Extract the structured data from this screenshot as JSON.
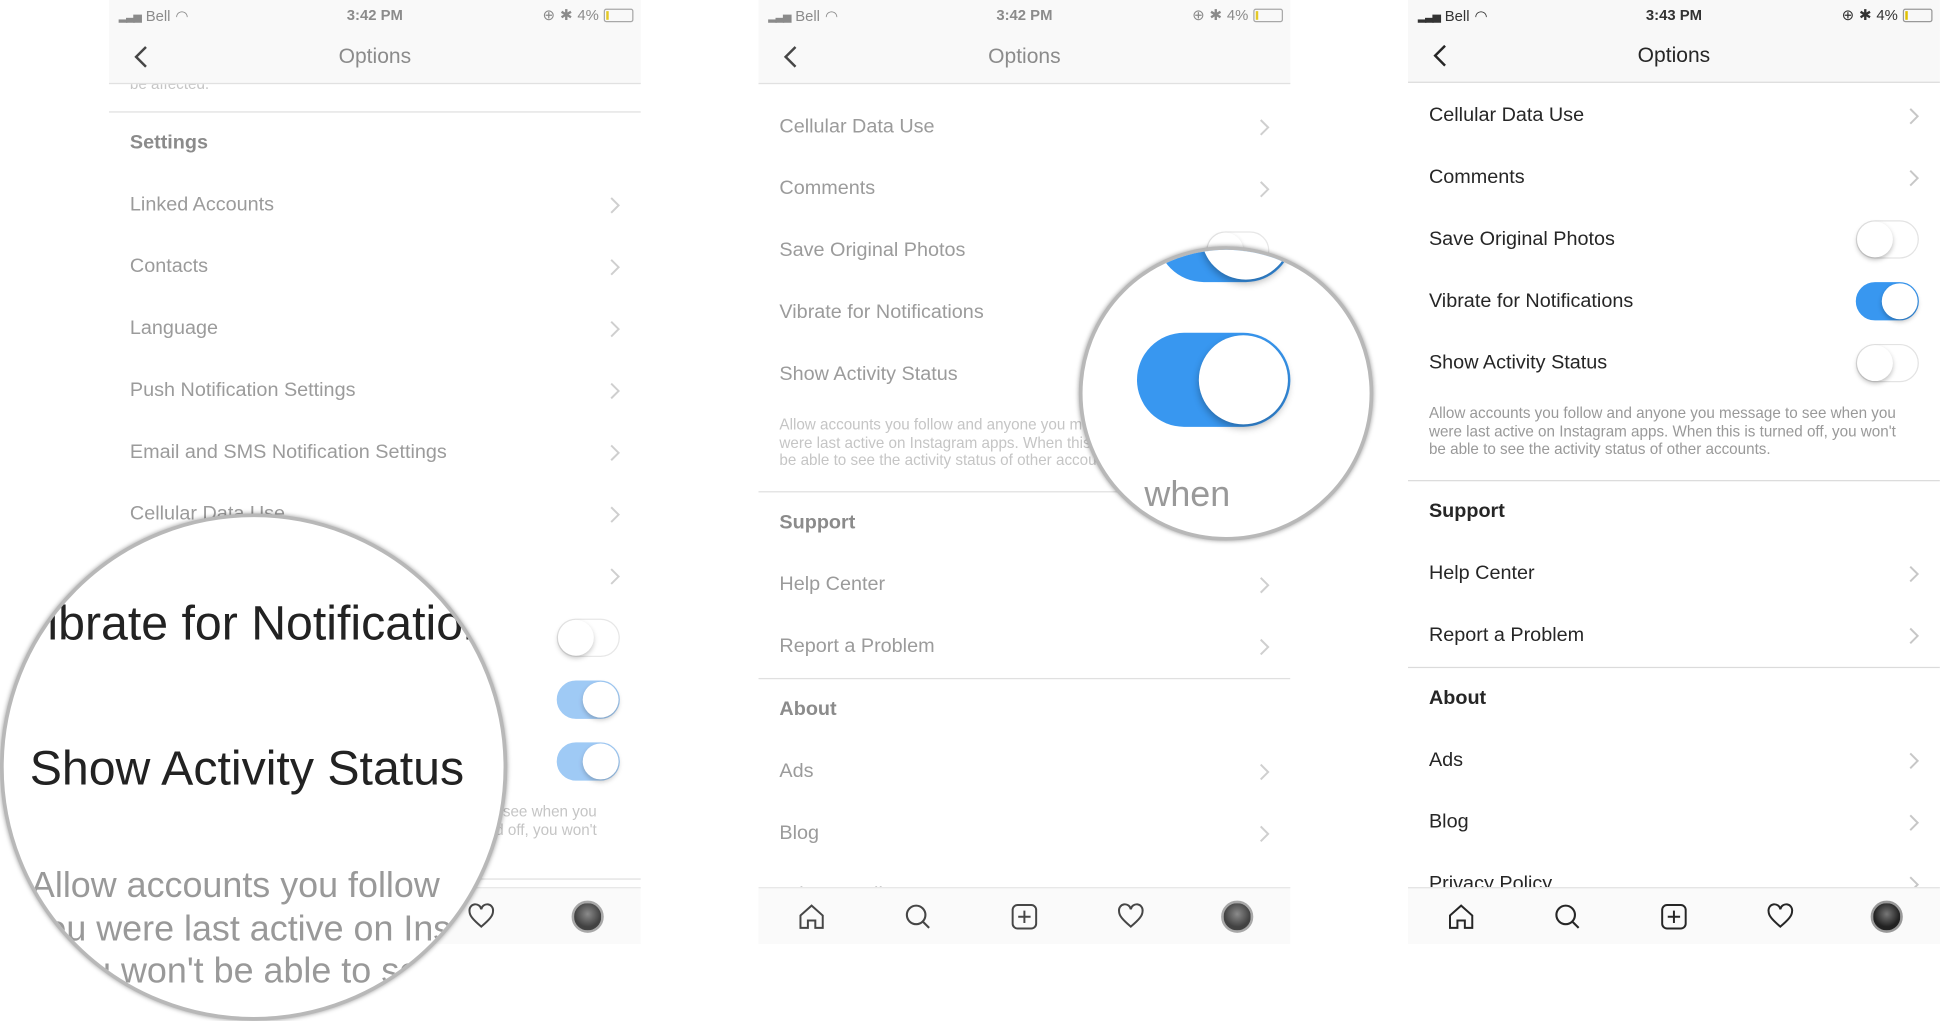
{
  "colors": {
    "accent": "#3897f0",
    "toggle_faded": "#8fc1f4",
    "text": "#262626",
    "muted": "#999999"
  },
  "panels": [
    {
      "faded": true,
      "status": {
        "carrier": "Bell",
        "time": "3:42 PM",
        "battery": "4%"
      },
      "nav": {
        "title": "Options"
      },
      "rows": [
        {
          "type": "desc",
          "text": "be affected."
        },
        {
          "type": "header",
          "label": "Settings"
        },
        {
          "type": "link",
          "label": "Linked Accounts"
        },
        {
          "type": "link",
          "label": "Contacts"
        },
        {
          "type": "link",
          "label": "Language"
        },
        {
          "type": "link",
          "label": "Push Notification Settings"
        },
        {
          "type": "link",
          "label": "Email and SMS Notification Settings"
        },
        {
          "type": "link",
          "label": "Cellular Data Use"
        },
        {
          "type": "link",
          "label": ""
        },
        {
          "type": "toggle",
          "label": "",
          "on": false
        },
        {
          "type": "toggle",
          "label": "",
          "on": true
        },
        {
          "type": "toggle",
          "label": "",
          "on": true
        },
        {
          "type": "desc",
          "text": "Allow accounts you follow and anyone you message to see when you were last active on Instagram apps. When this is turned off, you won't be able to see the activity status of other accounts."
        }
      ],
      "tabs": [
        "home-icon",
        "search-icon",
        "add-icon",
        "heart-icon",
        "profile-avatar"
      ]
    },
    {
      "faded": true,
      "status": {
        "carrier": "Bell",
        "time": "3:42 PM",
        "battery": "4%"
      },
      "nav": {
        "title": "Options"
      },
      "rows": [
        {
          "type": "link",
          "label": "Cellular Data Use"
        },
        {
          "type": "link",
          "label": "Comments"
        },
        {
          "type": "toggle",
          "label": "Save Original Photos",
          "on": false
        },
        {
          "type": "toggle",
          "label": "Vibrate for Notifications",
          "on": true
        },
        {
          "type": "toggle",
          "label": "Show Activity Status",
          "on": true
        },
        {
          "type": "desc",
          "text": "Allow accounts you follow and anyone you message to see when you were last active on Instagram apps. When this is turned off, you won't be able to see the activity status of other accounts."
        },
        {
          "type": "header",
          "label": "Support"
        },
        {
          "type": "link",
          "label": "Help Center"
        },
        {
          "type": "link",
          "label": "Report a Problem"
        },
        {
          "type": "divider"
        },
        {
          "type": "header",
          "label": "About"
        },
        {
          "type": "link",
          "label": "Ads"
        },
        {
          "type": "link",
          "label": "Blog"
        },
        {
          "type": "link",
          "label": "Privacy Policy"
        }
      ],
      "tabs": [
        "home-icon",
        "search-icon",
        "add-icon",
        "heart-icon",
        "profile-avatar"
      ]
    },
    {
      "faded": false,
      "status": {
        "carrier": "Bell",
        "time": "3:43 PM",
        "battery": "4%"
      },
      "nav": {
        "title": "Options"
      },
      "rows": [
        {
          "type": "link",
          "label": "Cellular Data Use"
        },
        {
          "type": "link",
          "label": "Comments"
        },
        {
          "type": "toggle",
          "label": "Save Original Photos",
          "on": false
        },
        {
          "type": "toggle",
          "label": "Vibrate for Notifications",
          "on": true
        },
        {
          "type": "toggle",
          "label": "Show Activity Status",
          "on": false
        },
        {
          "type": "desc",
          "text": "Allow accounts you follow and anyone you message to see when you were last active on Instagram apps. When this is turned off, you won't be able to see the activity status of other accounts."
        },
        {
          "type": "header",
          "label": "Support"
        },
        {
          "type": "link",
          "label": "Help Center"
        },
        {
          "type": "link",
          "label": "Report a Problem"
        },
        {
          "type": "divider"
        },
        {
          "type": "header",
          "label": "About"
        },
        {
          "type": "link",
          "label": "Ads"
        },
        {
          "type": "link",
          "label": "Blog"
        },
        {
          "type": "link",
          "label": "Privacy Policy"
        }
      ],
      "tabs": [
        "home-icon",
        "search-icon",
        "add-icon",
        "heart-icon",
        "profile-avatar"
      ]
    }
  ],
  "magnifier1": {
    "lines": [
      "Vibrate for Notifications",
      "Show Activity Status"
    ],
    "desc": [
      "Allow accounts you follow",
      "you were last active on Instagram",
      "you won't be able to see"
    ]
  },
  "magnifier2": {
    "text": "when",
    "toggle_on": true
  }
}
